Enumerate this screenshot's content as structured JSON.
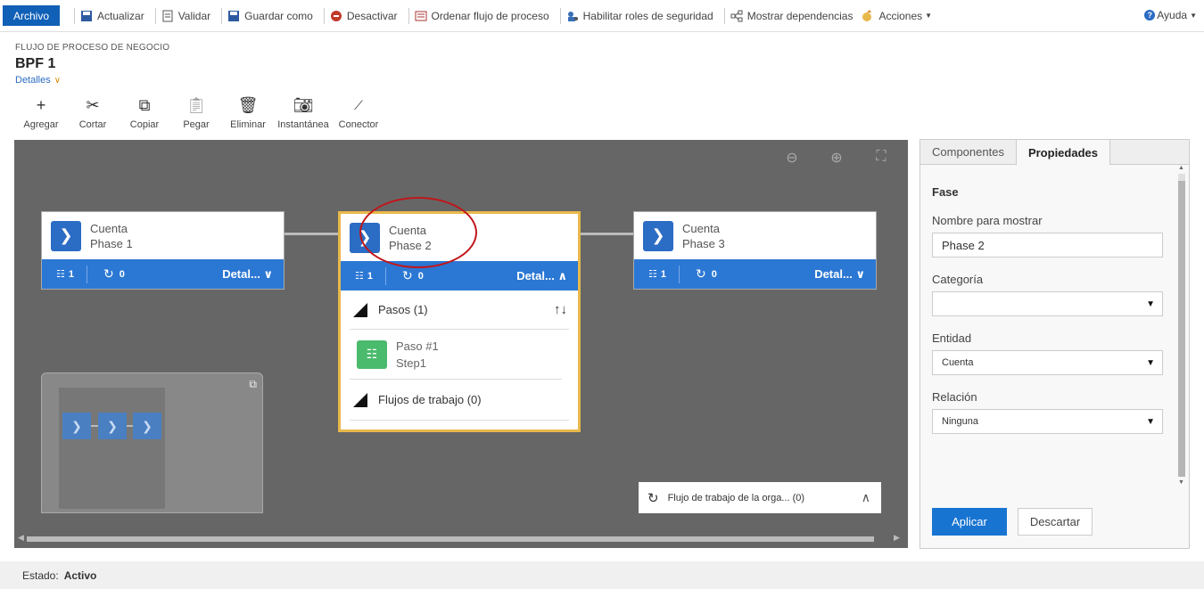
{
  "commandbar": {
    "archivo": "Archivo",
    "items": [
      "Actualizar",
      "Validar",
      "Guardar como",
      "Desactivar",
      "Ordenar flujo de proceso",
      "Habilitar roles de seguridad",
      "Mostrar dependencias",
      "Acciones"
    ],
    "help": "Ayuda"
  },
  "header": {
    "subtitle": "FLUJO DE PROCESO DE NEGOCIO",
    "title": "BPF 1",
    "details": "Detalles"
  },
  "toolbar": {
    "add": "Agregar",
    "cut": "Cortar",
    "copy": "Copiar",
    "paste": "Pegar",
    "delete": "Eliminar",
    "snapshot": "Instantánea",
    "connector": "Conector"
  },
  "stages": [
    {
      "entity": "Cuenta",
      "name": "Phase 1",
      "steps": "1",
      "workflows": "0",
      "details": "Detal..."
    },
    {
      "entity": "Cuenta",
      "name": "Phase 2",
      "steps": "1",
      "workflows": "0",
      "details": "Detal..."
    },
    {
      "entity": "Cuenta",
      "name": "Phase 3",
      "steps": "1",
      "workflows": "0",
      "details": "Detal..."
    }
  ],
  "expanded": {
    "steps_label": "Pasos (1)",
    "step_title": "Paso #1",
    "step_name": "Step1",
    "workflows_label": "Flujos de trabajo (0)"
  },
  "org_workflow": "Flujo de trabajo de la orga... (0)",
  "panel": {
    "tabs": [
      "Componentes",
      "Propiedades"
    ],
    "section": "Fase",
    "display_name_label": "Nombre para mostrar",
    "display_name_value": "Phase 2",
    "category_label": "Categoría",
    "category_value": "",
    "entity_label": "Entidad",
    "entity_value": "Cuenta",
    "relation_label": "Relación",
    "relation_value": "Ninguna",
    "apply": "Aplicar",
    "discard": "Descartar"
  },
  "status": {
    "label": "Estado:",
    "value": "Activo"
  },
  "colors": {
    "accent": "#2b77d4",
    "selected_border": "#e8b84a",
    "annotation": "#c0161a",
    "step_icon": "#4aba6c"
  }
}
